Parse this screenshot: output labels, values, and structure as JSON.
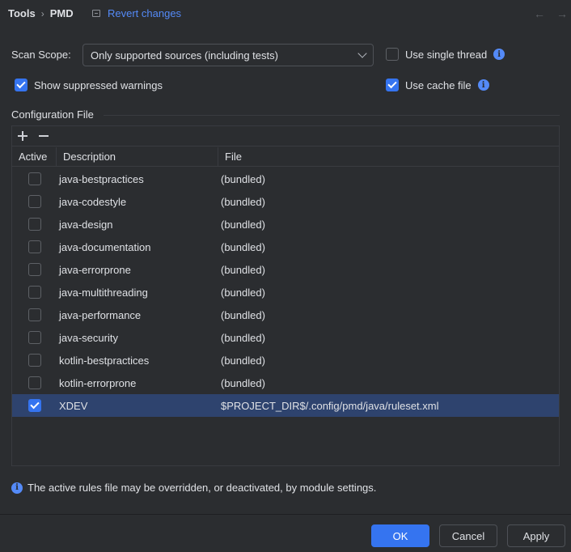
{
  "header": {
    "breadcrumb": [
      "Tools",
      "PMD"
    ],
    "revert_label": "Revert changes",
    "nav_back": "←",
    "nav_forward": "→"
  },
  "scope": {
    "label": "Scan Scope:",
    "selected": "Only supported sources (including tests)"
  },
  "options": {
    "single_thread": {
      "label": "Use single thread",
      "checked": false
    },
    "suppressed": {
      "label": "Show suppressed warnings",
      "checked": true
    },
    "cache": {
      "label": "Use cache file",
      "checked": true
    }
  },
  "config": {
    "title": "Configuration File",
    "columns": [
      "Active",
      "Description",
      "File"
    ],
    "rows": [
      {
        "active": false,
        "description": "java-bestpractices",
        "file": "(bundled)"
      },
      {
        "active": false,
        "description": "java-codestyle",
        "file": "(bundled)"
      },
      {
        "active": false,
        "description": "java-design",
        "file": "(bundled)"
      },
      {
        "active": false,
        "description": "java-documentation",
        "file": "(bundled)"
      },
      {
        "active": false,
        "description": "java-errorprone",
        "file": "(bundled)"
      },
      {
        "active": false,
        "description": "java-multithreading",
        "file": "(bundled)"
      },
      {
        "active": false,
        "description": "java-performance",
        "file": "(bundled)"
      },
      {
        "active": false,
        "description": "java-security",
        "file": "(bundled)"
      },
      {
        "active": false,
        "description": "kotlin-bestpractices",
        "file": "(bundled)"
      },
      {
        "active": false,
        "description": "kotlin-errorprone",
        "file": "(bundled)"
      },
      {
        "active": true,
        "description": "XDEV",
        "file": "$PROJECT_DIR$/.config/pmd/java/ruleset.xml",
        "selected": true
      }
    ]
  },
  "note": "The active rules file may be overridden, or deactivated, by module settings.",
  "buttons": {
    "ok": "OK",
    "cancel": "Cancel",
    "apply": "Apply"
  },
  "colors": {
    "accent": "#3574f0",
    "link": "#548af7",
    "background": "#2b2d30",
    "selection": "#2e436e"
  }
}
